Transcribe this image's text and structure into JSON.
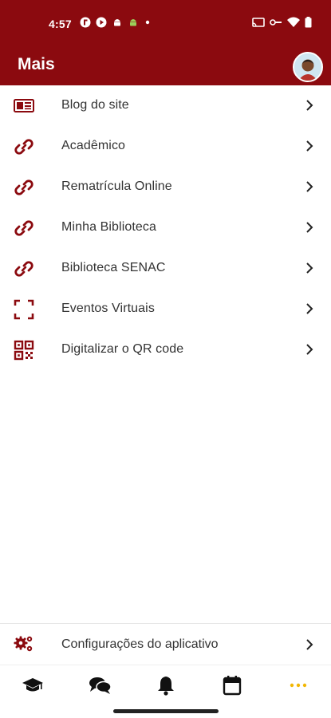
{
  "status_bar": {
    "time": "4:57"
  },
  "app_bar": {
    "title": "Mais"
  },
  "menu": {
    "items": [
      {
        "label": "Blog do site",
        "icon": "newspaper-icon"
      },
      {
        "label": "Acadêmico",
        "icon": "link-icon"
      },
      {
        "label": "Rematrícula Online",
        "icon": "link-icon"
      },
      {
        "label": "Minha Biblioteca",
        "icon": "link-icon"
      },
      {
        "label": "Biblioteca SENAC",
        "icon": "link-icon"
      },
      {
        "label": "Eventos Virtuais",
        "icon": "scan-frame-icon"
      },
      {
        "label": "Digitalizar o QR code",
        "icon": "qr-code-icon"
      }
    ]
  },
  "settings": {
    "label": "Configurações do aplicativo",
    "icon": "gears-icon"
  },
  "bottom_nav": {
    "items": [
      "graduation-cap-icon",
      "chat-bubbles-icon",
      "bell-icon",
      "calendar-icon",
      "more-dots-icon"
    ],
    "active_color": "#f2b705"
  },
  "colors": {
    "brand": "#8b0a0f",
    "text": "#333333",
    "icon": "#8b0a0f"
  }
}
